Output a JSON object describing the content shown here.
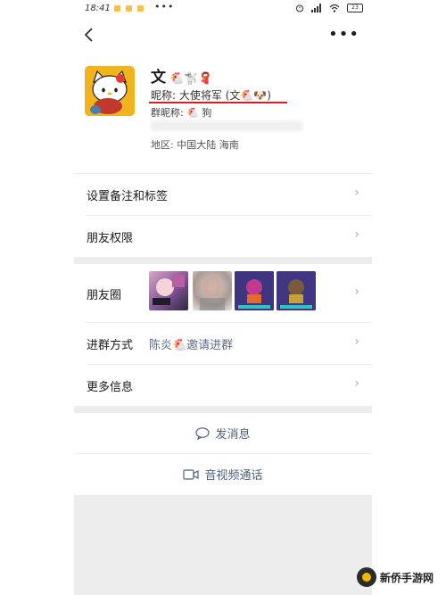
{
  "status_bar": {
    "time": "18:41",
    "menu_glyph": "•••",
    "battery": "23"
  },
  "nav": {
    "back_icon": "chevron-left-icon",
    "more_glyph": "•••"
  },
  "profile": {
    "name": "文",
    "name_emoji": "🐔🐩🧣",
    "nickname_label": "昵称:",
    "nickname_value": "大使将军 (文🐔🐶)",
    "group_nick_label": "群昵称:",
    "group_nick_value": "🐔 狗",
    "region_label": "地区:",
    "region_value": "中国大陆 海南"
  },
  "menu": {
    "remark": "设置备注和标签",
    "permission": "朋友权限",
    "moments": "朋友圈",
    "join_method_label": "进群方式",
    "join_method_value": "陈炎🐔邀请进群",
    "more_info": "更多信息"
  },
  "actions": {
    "message": "发消息",
    "video_call": "音视频通话"
  },
  "watermark": {
    "text": "新侨手游网"
  },
  "colors": {
    "accent_link": "#5b6b8c",
    "annotation_red": "#d91f1f",
    "background_gray": "#ededed"
  }
}
